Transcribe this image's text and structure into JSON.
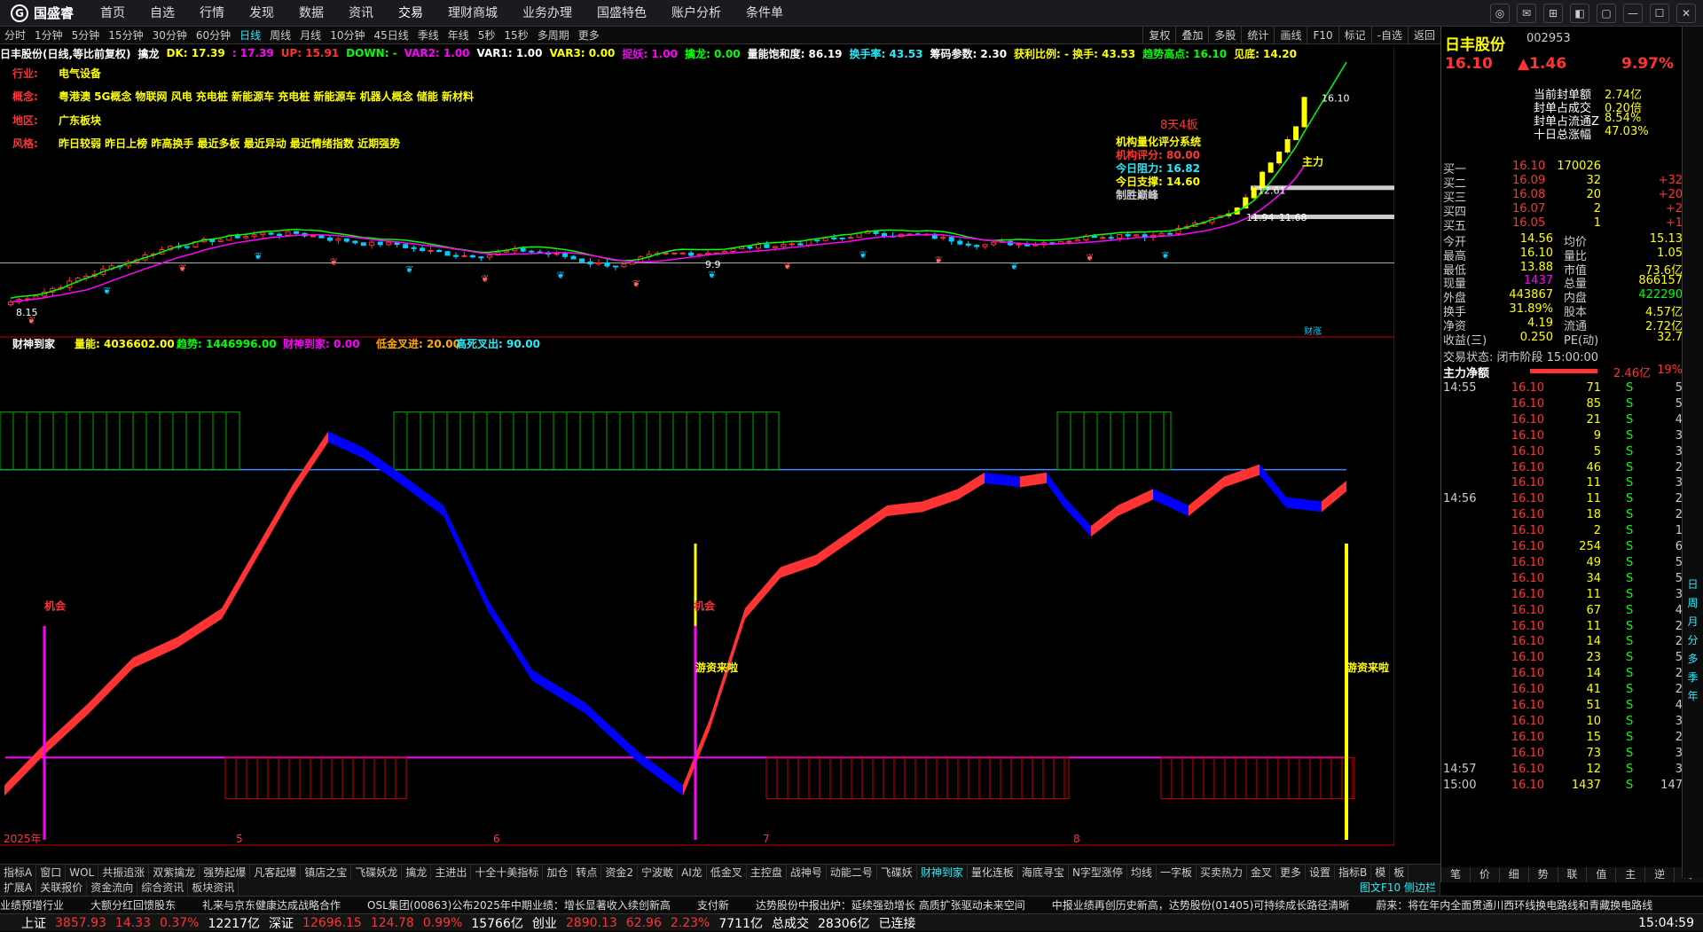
{
  "app": {
    "name": "国盛睿"
  },
  "menu": [
    "首页",
    "自选",
    "行情",
    "发现",
    "数据",
    "资讯",
    "交易",
    "理财商城",
    "业务办理",
    "国盛特色",
    "账户分析",
    "条件单"
  ],
  "periods": [
    "分时",
    "1分钟",
    "5分钟",
    "15分钟",
    "30分钟",
    "60分钟",
    "日线",
    "周线",
    "月线",
    "10分钟",
    "45日线",
    "季线",
    "年线",
    "5秒",
    "15秒",
    "多周期",
    "更多"
  ],
  "active_period": "日线",
  "right_tools": [
    "复权",
    "叠加",
    "多股",
    "统计",
    "画线",
    "F10",
    "标记",
    "-自选",
    "返回"
  ],
  "kinfo": [
    {
      "t": "日丰股份(日线,等比前复权)",
      "c": "w"
    },
    {
      "t": "擒龙",
      "c": "w"
    },
    {
      "t": "DK: 17.39",
      "c": "y"
    },
    {
      "t": ": 17.39",
      "c": "m"
    },
    {
      "t": "UP: 15.91",
      "c": "r"
    },
    {
      "t": "DOWN: -",
      "c": "g"
    },
    {
      "t": "VAR2: 1.00",
      "c": "m"
    },
    {
      "t": "VAR1: 1.00",
      "c": "w"
    },
    {
      "t": "VAR3: 0.00",
      "c": "y"
    },
    {
      "t": "捉妖: 1.00",
      "c": "m"
    },
    {
      "t": "擒龙: 0.00",
      "c": "g"
    },
    {
      "t": "量能饱和度: 86.19",
      "c": "w"
    },
    {
      "t": "换手率: 43.53",
      "c": "c"
    },
    {
      "t": "筹码参数: 2.30",
      "c": "w"
    },
    {
      "t": "获利比例: - 换手: 43.53",
      "c": "y"
    },
    {
      "t": "趋势高点: 16.10",
      "c": "g"
    },
    {
      "t": "见底: 14.20",
      "c": "y"
    }
  ],
  "info": {
    "industry_label": "行业:",
    "industry": "电气设备",
    "concept_label": "概念:",
    "concept": "粤港澳 5G概念 物联网 风电 充电桩 新能源车 充电桩 新能源车 机器人概念 储能 新材料",
    "region_label": "地区:",
    "region": "广东板块",
    "style_label": "风格:",
    "style": "昨日较弱 昨日上榜 昨高换手 最近多板 最近异动 最近情绪指数 近期强势"
  },
  "quant": {
    "title": "机构量化评分系统",
    "score": "机构评分: 80.00",
    "resist": "今日阻力: 16.82",
    "support": "今日支撑: 14.60",
    "tag": "制胜巅峰"
  },
  "price_axis": [
    "17.00",
    "16.00",
    "15.00",
    "14.00",
    "13.00",
    "12.00",
    "11.00",
    "10.00",
    "9.00",
    "8.00"
  ],
  "osc_axis": [
    "100.0",
    "90.00",
    "80.00",
    "70.00",
    "60.00",
    "50.00",
    "40.00",
    "30.00",
    "20.00"
  ],
  "osc_title": {
    "name": "财神到家",
    "liang": "量能: 4036602.00",
    "trend": "趋势: 1446996.00",
    "csdj": "财神到家: 0.00",
    "low": "低金叉进: 20.00",
    "high": "高死叉出: 90.00"
  },
  "labels": {
    "chance": "机会",
    "fund": "游资来啦",
    "low": "8.15",
    "p1261": "12.61",
    "p1194": "11.94",
    "p1168": "11.68",
    "p9": "9.9",
    "date2025": "2025年",
    "m5": "5",
    "m6": "6",
    "m7": "7",
    "m8": "8",
    "dayline": "日线",
    "caizhang": "财涨",
    "zhu": "主力",
    "board": "8天4板",
    "p1610": "16.10"
  },
  "stock": {
    "name": "日丰股份",
    "code": "002953",
    "price": "16.10",
    "change": "▲1.46",
    "pct": "9.97%"
  },
  "seal": [
    [
      "当前封单额",
      "2.74亿"
    ],
    [
      "封单占成交",
      "0.20倍"
    ],
    [
      "封单占流通Z",
      "8.54%"
    ],
    [
      "十日总涨幅",
      "47.03%"
    ]
  ],
  "bids": [
    [
      "买一",
      "16.10",
      "170026",
      ""
    ],
    [
      "买二",
      "16.09",
      "32",
      "+32"
    ],
    [
      "买三",
      "16.08",
      "20",
      "+20"
    ],
    [
      "买四",
      "16.07",
      "2",
      "+2"
    ],
    [
      "买五",
      "16.05",
      "1",
      "+1"
    ]
  ],
  "quote": [
    [
      "今开",
      "14.56",
      "均价",
      "15.13"
    ],
    [
      "最高",
      "16.10",
      "量比",
      "1.05"
    ],
    [
      "最低",
      "13.88",
      "市值",
      "73.6亿"
    ],
    [
      "现量",
      "1437",
      "总量",
      "866157"
    ],
    [
      "外盘",
      "443867",
      "内盘",
      "422290"
    ],
    [
      "换手",
      "31.89%",
      "股本",
      "4.57亿"
    ],
    [
      "净资",
      "4.19",
      "流通",
      "2.72亿"
    ],
    [
      "收益(三)",
      "0.250",
      "PE(动)",
      "32.7"
    ]
  ],
  "trade_status": "交易状态: 闭市阶段 15:00:00",
  "netflow": {
    "label": "主力净额",
    "val": "2.46亿",
    "pct": "19%"
  },
  "ticks": [
    {
      "t": "14:55",
      "p": "16.10",
      "v": "71",
      "f": "S",
      "n": "5"
    },
    {
      "t": "",
      "p": "16.10",
      "v": "85",
      "f": "S",
      "n": "5"
    },
    {
      "t": "",
      "p": "16.10",
      "v": "21",
      "f": "S",
      "n": "4"
    },
    {
      "t": "",
      "p": "16.10",
      "v": "9",
      "f": "S",
      "n": "3"
    },
    {
      "t": "",
      "p": "16.10",
      "v": "5",
      "f": "S",
      "n": "3"
    },
    {
      "t": "",
      "p": "16.10",
      "v": "46",
      "f": "S",
      "n": "2"
    },
    {
      "t": "",
      "p": "16.10",
      "v": "11",
      "f": "S",
      "n": "3"
    },
    {
      "t": "14:56",
      "p": "16.10",
      "v": "11",
      "f": "S",
      "n": "2"
    },
    {
      "t": "",
      "p": "16.10",
      "v": "18",
      "f": "S",
      "n": "2"
    },
    {
      "t": "",
      "p": "16.10",
      "v": "2",
      "f": "S",
      "n": "1"
    },
    {
      "t": "",
      "p": "16.10",
      "v": "254",
      "f": "S",
      "n": "6"
    },
    {
      "t": "",
      "p": "16.10",
      "v": "49",
      "f": "S",
      "n": "5"
    },
    {
      "t": "",
      "p": "16.10",
      "v": "34",
      "f": "S",
      "n": "5"
    },
    {
      "t": "",
      "p": "16.10",
      "v": "11",
      "f": "S",
      "n": "3"
    },
    {
      "t": "",
      "p": "16.10",
      "v": "67",
      "f": "S",
      "n": "4"
    },
    {
      "t": "",
      "p": "16.10",
      "v": "11",
      "f": "S",
      "n": "2"
    },
    {
      "t": "",
      "p": "16.10",
      "v": "14",
      "f": "S",
      "n": "2"
    },
    {
      "t": "",
      "p": "16.10",
      "v": "23",
      "f": "S",
      "n": "5"
    },
    {
      "t": "",
      "p": "16.10",
      "v": "14",
      "f": "S",
      "n": "2"
    },
    {
      "t": "",
      "p": "16.10",
      "v": "41",
      "f": "S",
      "n": "2"
    },
    {
      "t": "",
      "p": "16.10",
      "v": "51",
      "f": "S",
      "n": "4"
    },
    {
      "t": "",
      "p": "16.10",
      "v": "10",
      "f": "S",
      "n": "3"
    },
    {
      "t": "",
      "p": "16.10",
      "v": "15",
      "f": "S",
      "n": "2"
    },
    {
      "t": "",
      "p": "16.10",
      "v": "73",
      "f": "S",
      "n": "3"
    },
    {
      "t": "14:57",
      "p": "16.10",
      "v": "12",
      "f": "S",
      "n": "3"
    },
    {
      "t": "15:00",
      "p": "16.10",
      "v": "1437",
      "f": "S",
      "n": "147"
    }
  ],
  "rtabs": [
    "笔",
    "价",
    "细",
    "势",
    "联",
    "值",
    "主",
    "逆",
    "筹"
  ],
  "sidebar": [
    "日",
    "周",
    "月",
    "分",
    "多",
    "季",
    "年"
  ],
  "tabs": [
    "指标A",
    "窗口",
    "WOL",
    "共振追涨",
    "双紫擒龙",
    "强势起爆",
    "凡客起爆",
    "镇店之宝",
    "飞碟妖龙",
    "擒龙",
    "主进出",
    "十全十美指标",
    "加仓",
    "转点",
    "资金2",
    "宁波敢",
    "AI龙",
    "低金叉",
    "主控盘",
    "战神号",
    "动能二号",
    "飞碟妖",
    "财神到家",
    "量化连板",
    "海底寻宝",
    "N字型涨停",
    "均线",
    "一字板",
    "买卖热力",
    "金叉",
    "更多",
    "设置",
    "指标B",
    "模",
    "板"
  ],
  "active_tab": "财神到家",
  "tabs2": [
    "扩展A",
    "关联报价",
    "资金流向",
    "综合资讯",
    "板块资讯"
  ],
  "tabs2_right": "图文F10 侧边栏",
  "news": [
    "业绩预增行业",
    "大额分红回馈股东",
    "礼来与京东健康达成战略合作",
    "OSL集团(00863)公布2025年中期业绩：增长显著收入续创新高",
    "支付新",
    "达势股份中报出炉：延续强劲增长 高质扩张驱动未来空间",
    "中报业绩再创历史新高，达势股份(01405)可持续成长路径清晰",
    "蔚来：将在年内全面贯通川西环线换电路线和青藏换电路线"
  ],
  "status": {
    "sh_label": "上证",
    "sh": "3857.93",
    "sh_ch": "14.33",
    "sh_pct": "0.37%",
    "sh_amt": "12217亿",
    "sz_label": "深证",
    "sz": "12696.15",
    "sz_ch": "124.78",
    "sz_pct": "0.99%",
    "sz_amt": "15766亿",
    "cy_label": "创业",
    "cy": "2890.13",
    "cy_ch": "62.96",
    "cy_pct": "2.23%",
    "cy_amt": "7711亿",
    "total_label": "总成交",
    "total": "28306亿",
    "conn": "已连接",
    "time": "15:04:59"
  },
  "chart_data": {
    "type": "line",
    "title": "日丰股份(日线,等比前复权)",
    "price_ylim": [
      7.6,
      17.4
    ],
    "osc_ylim": [
      0,
      105
    ],
    "last_price": 16.1,
    "high": 16.1,
    "recent_lows": [
      8.15,
      9.9,
      11.68
    ]
  }
}
